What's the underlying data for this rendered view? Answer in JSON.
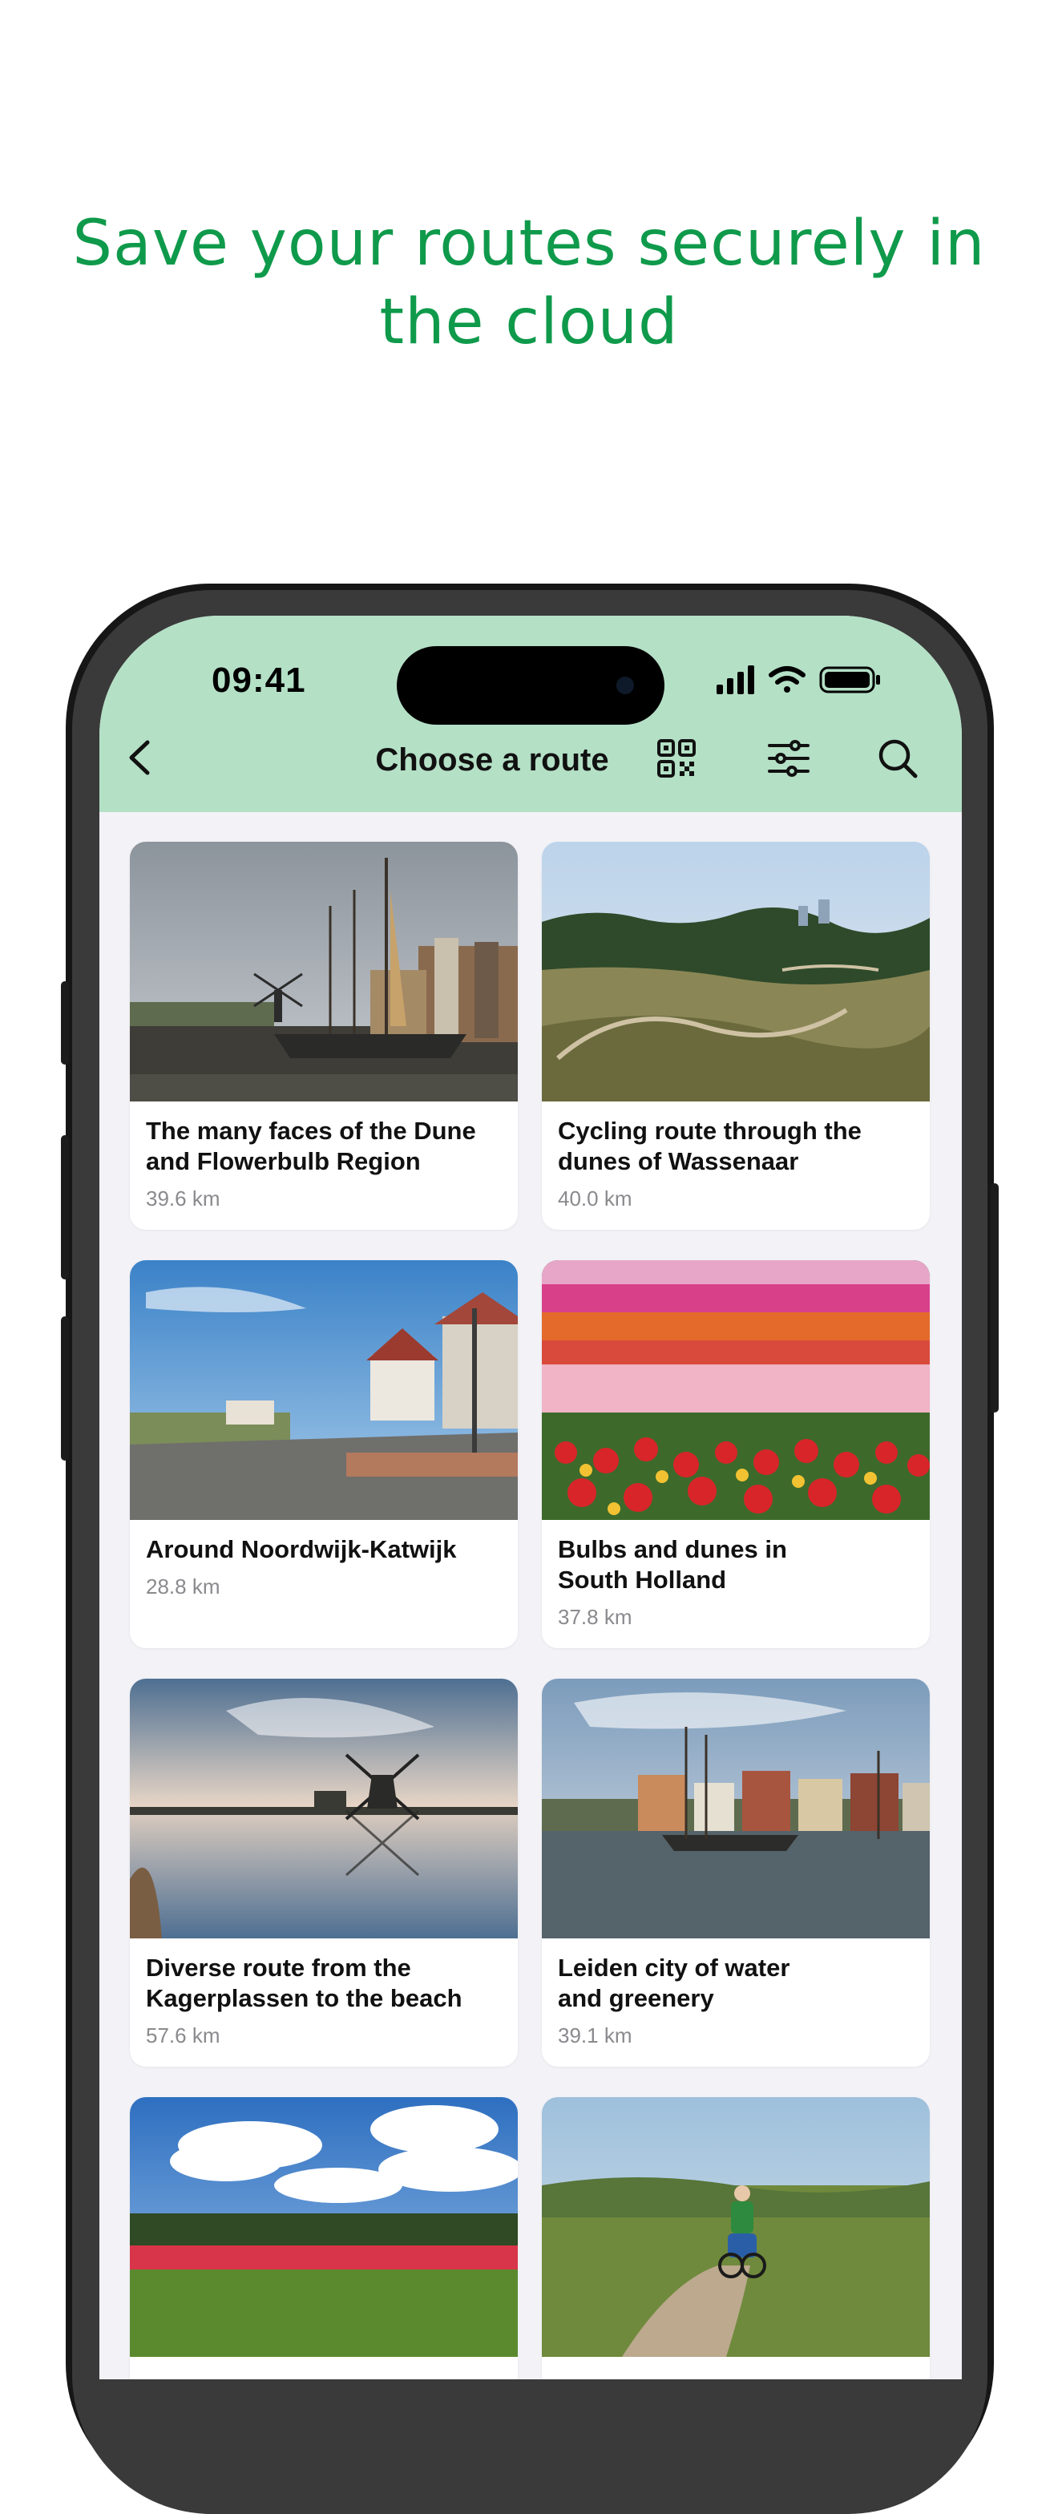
{
  "headline": {
    "line1": "Save your routes securely in",
    "line2": "the cloud"
  },
  "colors": {
    "headline": "#0f9a4b",
    "topbar": "#b4e0c6",
    "background": "#f2f2f7"
  },
  "status_bar": {
    "time": "09:41",
    "icons": [
      "signal-icon",
      "wifi-icon",
      "battery-icon"
    ]
  },
  "nav": {
    "title": "Choose a route",
    "buttons": [
      "back-icon",
      "qr-code-icon",
      "filter-icon",
      "search-icon"
    ]
  },
  "routes": [
    {
      "title": "The many faces of the Dune and Flowerbulb Region",
      "distance": "39.6 km",
      "photo": "harbour-with-windmill"
    },
    {
      "title": "Cycling route through the dunes of Wassenaar",
      "distance": "40.0 km",
      "photo": "dune-landscape"
    },
    {
      "title": "Around Noordwijk-Katwijk",
      "distance": "28.8 km",
      "photo": "seaside-promenade"
    },
    {
      "title": "Bulbs and dunes in South Holland",
      "distance": "37.8 km",
      "photo": "tulip-field"
    },
    {
      "title": "Diverse route from the Kagerplassen to the beach",
      "distance": "57.6 km",
      "photo": "windmill-reflection"
    },
    {
      "title": "Leiden city of water and greenery",
      "distance": "39.1 km",
      "photo": "city-canal"
    },
    {
      "title": "",
      "distance": "",
      "photo": "flower-field-clouds"
    },
    {
      "title": "",
      "distance": "",
      "photo": "cyclist-on-path"
    }
  ]
}
